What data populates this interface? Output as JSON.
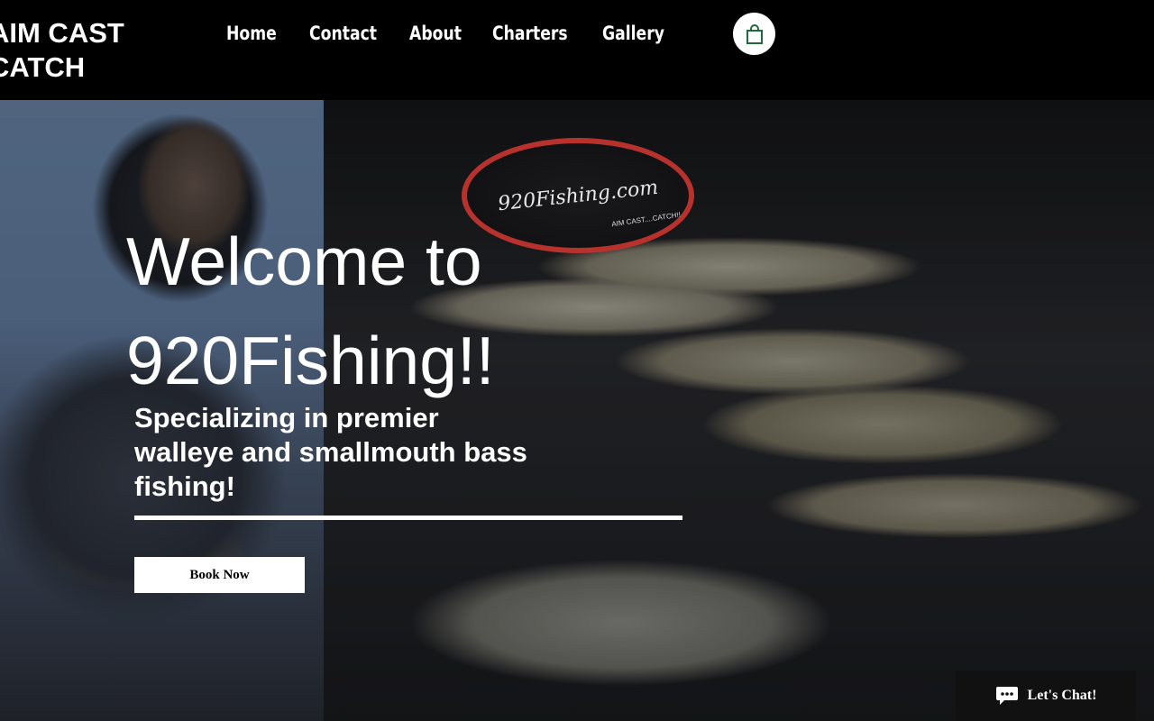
{
  "header": {
    "logo_line1": "AIM CAST",
    "logo_line2": "CATCH",
    "nav": [
      {
        "label": "Home"
      },
      {
        "label": "Contact"
      },
      {
        "label": "About"
      },
      {
        "label": "Charters"
      },
      {
        "label": "Gallery"
      }
    ],
    "cart_icon": "shopping-bag-icon"
  },
  "hero": {
    "title_line1": "Welcome to",
    "title_line2": "920Fishing!!",
    "subtitle_line1": "Specializing in premier",
    "subtitle_line2": "walleye and smallmouth bass",
    "subtitle_line3": "fishing!",
    "book_button": "Book Now",
    "sign_text": "920Fishing.com",
    "sign_subtext": "AIM CAST....CATCH!!"
  },
  "chat": {
    "icon": "chat-bubble-icon",
    "label": "Let's Chat!"
  },
  "colors": {
    "header_bg": "#000000",
    "accent": "#ffffff",
    "cart_icon": "#1d6b3a",
    "sign_border": "#b7322c"
  }
}
